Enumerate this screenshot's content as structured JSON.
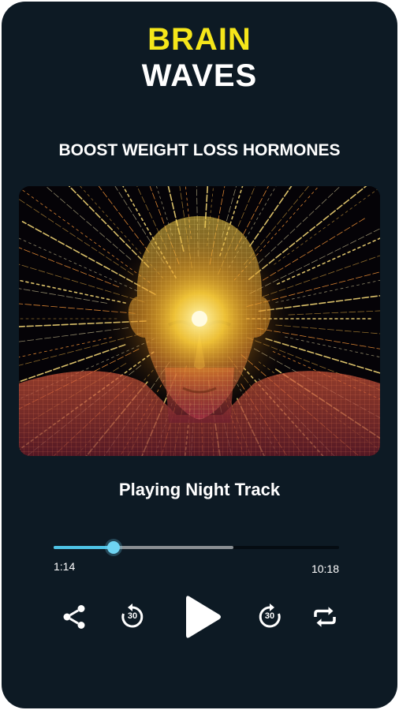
{
  "header": {
    "title_line1": "BRAIN",
    "title_line2": "WAVES",
    "subtitle": "BOOST WEIGHT LOSS HORMONES"
  },
  "player": {
    "track_name": "Playing Night Track",
    "elapsed": "1:14",
    "total": "10:18",
    "progress_fraction": 0.21,
    "buffered_fraction": 0.63,
    "rewind_seconds": "30",
    "forward_seconds": "30"
  },
  "controls": {
    "icons": [
      "share-icon",
      "rewind-30-icon",
      "play-icon",
      "forward-30-icon",
      "repeat-icon"
    ]
  },
  "colors": {
    "background": "#0d1a24",
    "title_accent": "#f5e61a",
    "progress": "#4ec3e6",
    "buffer": "#8a8f93"
  }
}
